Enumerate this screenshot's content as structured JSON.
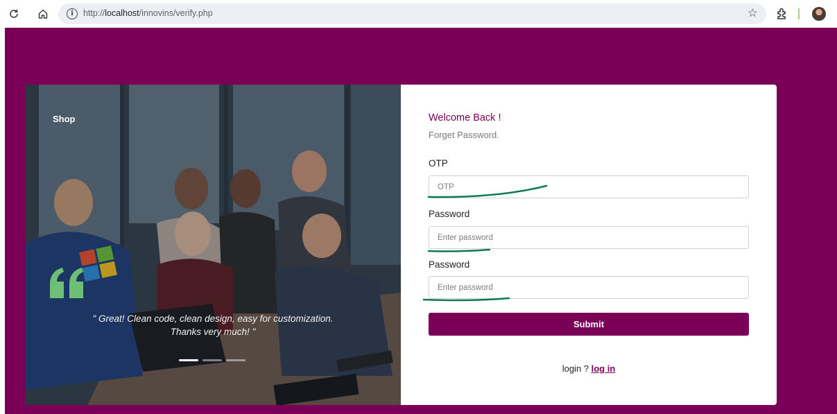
{
  "browser": {
    "url_prefix": "http://",
    "url_host": "localhost",
    "url_path": "/innovins/verify.php"
  },
  "hero": {
    "brand": "Shop",
    "quote": "\" Great! Clean code, clean design, easy for customization. Thanks very much! \"",
    "quote_line1": "\" Great! Clean code, clean design, easy for customization.",
    "quote_line2": "Thanks very much! \"",
    "slides_total": 3,
    "slide_active": 1
  },
  "form": {
    "welcome": "Welcome Back !",
    "subtitle": "Forget Password.",
    "otp_label": "OTP",
    "otp_placeholder": "OTP",
    "password_label": "Password",
    "password_placeholder": "Enter password",
    "confirm_label": "Password",
    "confirm_placeholder": "Enter password",
    "submit_label": "Submit",
    "login_prompt": "login ? ",
    "login_link": "log in"
  },
  "colors": {
    "brand": "#7a0057",
    "annotation": "#0b7a4f",
    "quote_icon": "#6dbf75"
  },
  "icons": [
    "reload-icon",
    "home-icon",
    "info-icon",
    "star-icon",
    "extensions-icon",
    "quote-icon"
  ]
}
